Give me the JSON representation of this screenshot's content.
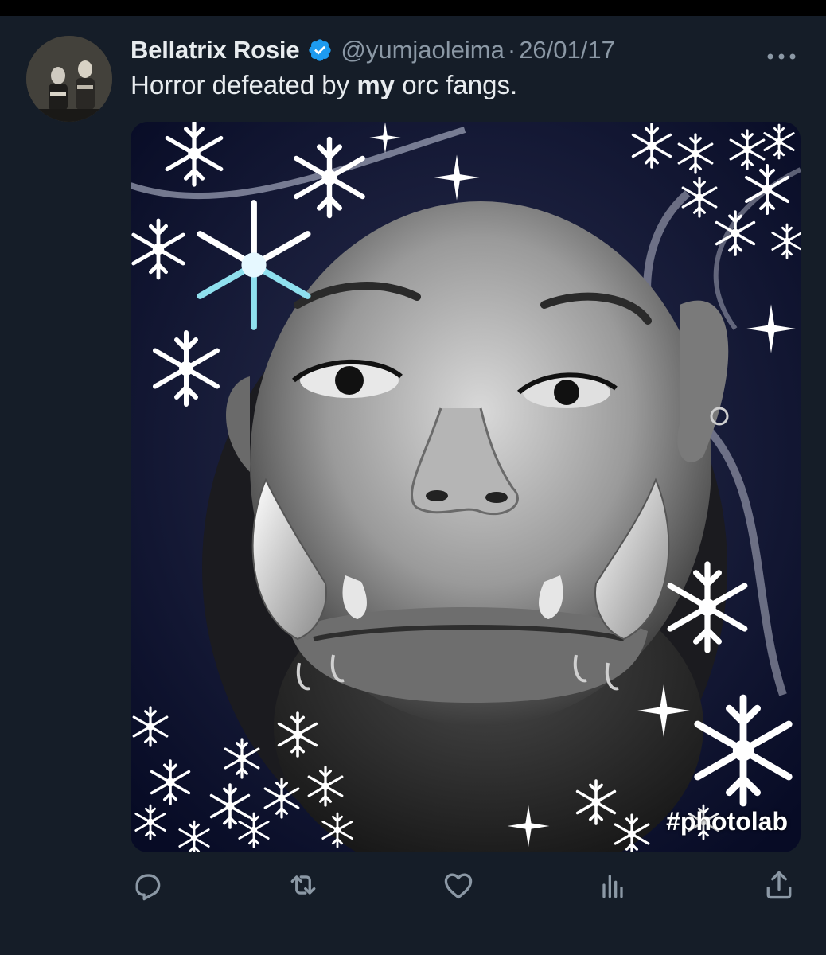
{
  "tweet": {
    "author": {
      "display_name": "Bellatrix Rosie",
      "verified": true,
      "handle": "@yumjaoleima",
      "separator": "·",
      "date": "26/01/17"
    },
    "text_before": "Horror defeated by ",
    "text_bold": "my",
    "text_after": " orc fangs.",
    "media": {
      "watermark": "#photolab"
    }
  },
  "icons": {
    "verified": "verified-badge-icon",
    "more": "more-horizontal-icon",
    "reply": "reply-icon",
    "retweet": "retweet-icon",
    "like": "heart-icon",
    "views": "views-icon",
    "share": "share-icon"
  },
  "colors": {
    "background": "#151d28",
    "primary_text": "#e8ecef",
    "secondary_text": "#8b98a5",
    "verified_blue": "#1d9bf0"
  }
}
